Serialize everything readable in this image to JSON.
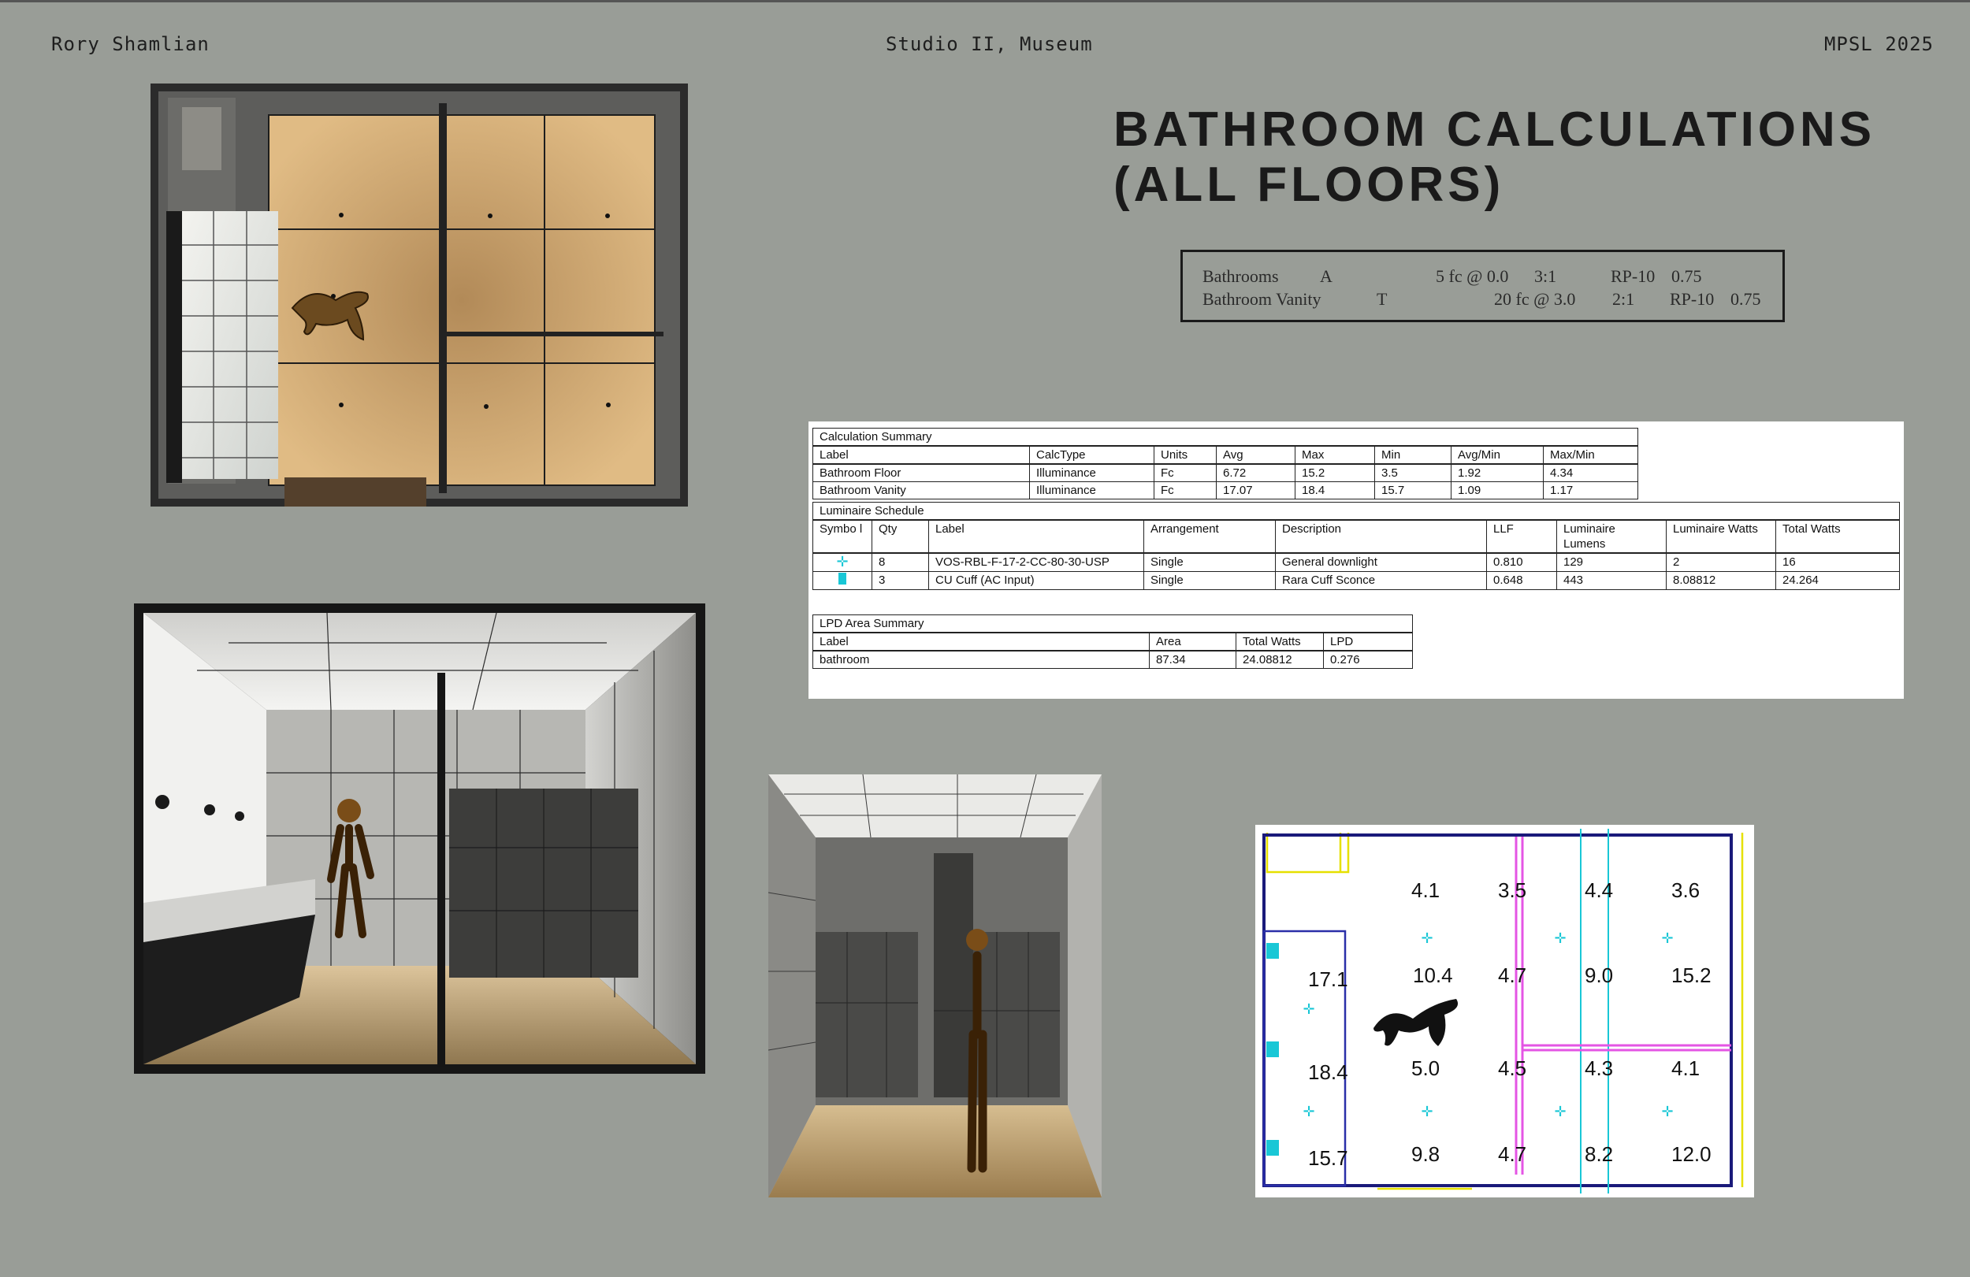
{
  "header": {
    "author": "Rory Shamlian",
    "course": "Studio II, Museum",
    "term": "MPSL 2025"
  },
  "title": {
    "line1": "BATHROOM CALCULATIONS",
    "line2": "(ALL FLOORS)"
  },
  "criteria": [
    {
      "space": "Bathrooms",
      "code": "A",
      "target": "5 fc @ 0.0",
      "ratio": "3:1",
      "ref": "RP-10",
      "factor": "0.75"
    },
    {
      "space": "Bathroom Vanity",
      "code": "T",
      "target": "20 fc @ 3.0",
      "ratio": "2:1",
      "ref": "RP-10",
      "factor": "0.75"
    }
  ],
  "calc_summary": {
    "title": "Calculation Summary",
    "headers": [
      "Label",
      "CalcType",
      "Units",
      "Avg",
      "Max",
      "Min",
      "Avg/Min",
      "Max/Min"
    ],
    "rows": [
      [
        "Bathroom Floor",
        "Illuminance",
        "Fc",
        "6.72",
        "15.2",
        "3.5",
        "1.92",
        "4.34"
      ],
      [
        "Bathroom Vanity",
        "Illuminance",
        "Fc",
        "17.07",
        "18.4",
        "15.7",
        "1.09",
        "1.17"
      ]
    ]
  },
  "luminaire_schedule": {
    "title": "Luminaire Schedule",
    "headers": [
      "Symbo l",
      "Qty",
      "Label",
      "Arrangement",
      "Description",
      "LLF",
      "Luminaire Lumens",
      "Luminaire Watts",
      "Total Watts"
    ],
    "rows": [
      [
        "",
        "8",
        "VOS-RBL-F-17-2-CC-80-30-USP",
        "Single",
        "General downlight",
        "0.810",
        "129",
        "2",
        "16"
      ],
      [
        "",
        "3",
        "CU Cuff (AC Input)",
        "Single",
        "Rara Cuff Sconce",
        "0.648",
        "443",
        "8.08812",
        "24.264"
      ]
    ]
  },
  "lpd_summary": {
    "title": "LPD Area Summary",
    "headers": [
      "Label",
      "Area",
      "Total Watts",
      "LPD"
    ],
    "rows": [
      [
        "bathroom",
        "87.34",
        "24.08812",
        "0.276"
      ]
    ]
  },
  "plot_values": [
    "4.1",
    "3.5",
    "4.4",
    "3.6",
    "17.1",
    "10.4",
    "4.7",
    "9.0",
    "15.2",
    "18.4",
    "5.0",
    "4.5",
    "4.3",
    "4.1",
    "15.7",
    "9.8",
    "4.7",
    "8.2",
    "12.0"
  ],
  "colors": {
    "background": "#999d97",
    "downlight": "#19c7d6",
    "vanity_zone": "#2a2fa8",
    "partition": "#e455e4"
  }
}
